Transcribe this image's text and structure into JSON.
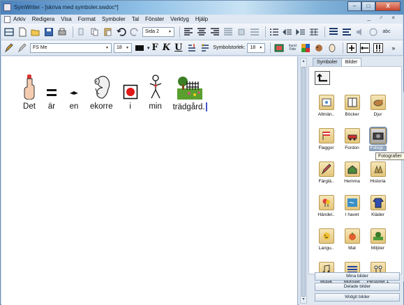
{
  "window": {
    "title": "SymWriter - [skriva med symboler.swdoc*]",
    "min_glyph": "–",
    "max_glyph": "□",
    "close_glyph": "X"
  },
  "menubar": {
    "items": [
      "Arkiv",
      "Redigera",
      "Visa",
      "Format",
      "Symboler",
      "Tal",
      "Fönster",
      "Verktyg",
      "Hjälp"
    ],
    "mdi_controls": "_ ♂ ×"
  },
  "toolbar": {
    "page_combo": "Sida 2",
    "font_name": "FS Me",
    "font_size": "18",
    "bold_label": "F",
    "italic_label": "K",
    "underline_label": "U",
    "symbol_size_label": "Symbolstorlek:",
    "symbol_size_value": "18",
    "abc_label": "abc",
    "overflow_glyph": "»"
  },
  "document": {
    "words": [
      {
        "text": "Det",
        "symbol": "pointing-hand"
      },
      {
        "text": "är",
        "symbol": "equals"
      },
      {
        "text": "en",
        "symbol": "dash"
      },
      {
        "text": "ekorre",
        "symbol": "squirrel"
      },
      {
        "text": "i",
        "symbol": "box-with-dot"
      },
      {
        "text": "min",
        "symbol": "person-self"
      },
      {
        "text": "trädgård.",
        "symbol": "garden"
      }
    ]
  },
  "panel": {
    "tabs": [
      "Symboler",
      "Bilder"
    ],
    "active_tab": "Bilder",
    "folders": [
      {
        "label": "Allmän..",
        "icon": "folder-general-icon"
      },
      {
        "label": "Böcker",
        "icon": "book-icon"
      },
      {
        "label": "Djur",
        "icon": "animal-icon"
      },
      {
        "label": "Flaggor",
        "icon": "flag-icon"
      },
      {
        "label": "Fordon",
        "icon": "car-icon"
      },
      {
        "label": "Fotogr..",
        "icon": "camera-icon"
      },
      {
        "label": "Färglä..",
        "icon": "pencil-icon"
      },
      {
        "label": "Hemma",
        "icon": "home-icon"
      },
      {
        "label": "Historia",
        "icon": "history-icon"
      },
      {
        "label": "Händel..",
        "icon": "balloon-icon"
      },
      {
        "label": "I havet",
        "icon": "sea-icon"
      },
      {
        "label": "Kläder",
        "icon": "clothes-icon"
      },
      {
        "label": "Langu..",
        "icon": "language-icon"
      },
      {
        "label": "Mat",
        "icon": "food-icon"
      },
      {
        "label": "Miljöer",
        "icon": "environment-icon"
      },
      {
        "label": "Musik",
        "icon": "music-icon"
      },
      {
        "label": "Mönster",
        "icon": "pattern-icon"
      },
      {
        "label": "Personer 1",
        "icon": "people-icon"
      }
    ],
    "selected_folder": "Fotogr..",
    "tooltip": "Fotografier",
    "buttons": [
      "Mina bilder",
      "Delade bilder",
      "Widgit bilder"
    ]
  },
  "colors": {
    "titlebar": "#4a82bd",
    "caret": "#4455cc",
    "folder": "#e4c57a"
  }
}
